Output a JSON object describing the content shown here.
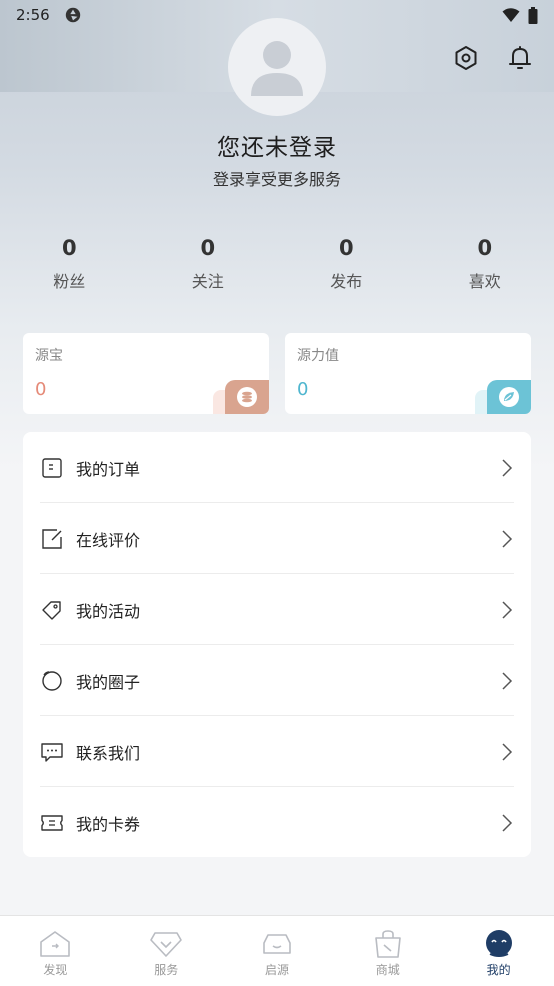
{
  "status_bar": {
    "time": "2:56"
  },
  "profile": {
    "title": "您还未登录",
    "subtitle": "登录享受更多服务"
  },
  "stats": [
    {
      "value": "0",
      "label": "粉丝"
    },
    {
      "value": "0",
      "label": "关注"
    },
    {
      "value": "0",
      "label": "发布"
    },
    {
      "value": "0",
      "label": "喜欢"
    }
  ],
  "cards": {
    "yuanbao": {
      "label": "源宝",
      "value": "0",
      "color": "#e58a78",
      "icon": "coin-stack-icon"
    },
    "yuanli": {
      "label": "源力值",
      "value": "0",
      "color": "#4fb6cf",
      "icon": "leaf-icon"
    }
  },
  "menu": [
    {
      "label": "我的订单",
      "icon": "order-icon"
    },
    {
      "label": "在线评价",
      "icon": "edit-icon"
    },
    {
      "label": "我的活动",
      "icon": "tag-icon"
    },
    {
      "label": "我的圈子",
      "icon": "circle-icon"
    },
    {
      "label": "联系我们",
      "icon": "chat-icon"
    },
    {
      "label": "我的卡券",
      "icon": "ticket-icon"
    }
  ],
  "tabbar": [
    {
      "label": "发现",
      "icon": "home-icon"
    },
    {
      "label": "服务",
      "icon": "diamond-icon"
    },
    {
      "label": "启源",
      "icon": "car-icon"
    },
    {
      "label": "商城",
      "icon": "shopping-bag-icon"
    },
    {
      "label": "我的",
      "icon": "mascot-icon",
      "active": true
    }
  ],
  "colors": {
    "accent": "#1f3d66",
    "tab_inactive": "#999999"
  }
}
